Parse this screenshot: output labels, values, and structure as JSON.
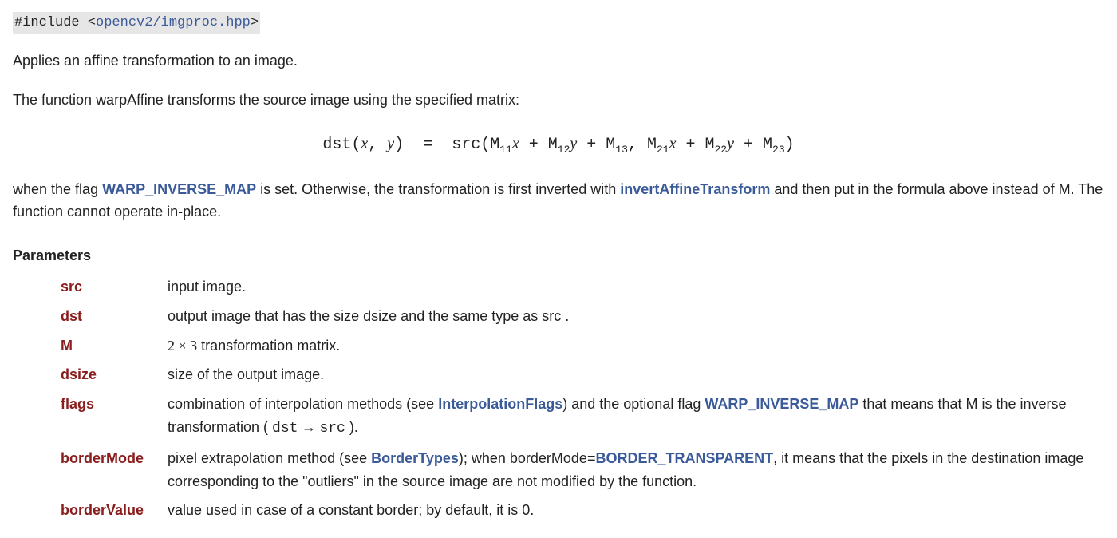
{
  "include": {
    "prefix": "#include <",
    "path": "opencv2/imgproc.hpp",
    "suffix": ">"
  },
  "intro1": "Applies an affine transformation to an image.",
  "intro2": "The function warpAffine transforms the source image using the specified matrix:",
  "formula": {
    "dst": "dst",
    "src": "src",
    "x": "x",
    "y": "y",
    "M11": "M",
    "s11": "11",
    "M12": "M",
    "s12": "12",
    "M13": "M",
    "s13": "13",
    "M21": "M",
    "s21": "21",
    "M22": "M",
    "s22": "22",
    "M23": "M",
    "s23": "23"
  },
  "afterFormula": {
    "t1": "when the flag ",
    "link1": "WARP_INVERSE_MAP",
    "t2": " is set. Otherwise, the transformation is first inverted with ",
    "link2": "invertAffineTransform",
    "t3": " and then put in the formula above instead of M. The function cannot operate in-place."
  },
  "paramsHeading": "Parameters",
  "params": {
    "src": {
      "name": "src",
      "desc": "input image."
    },
    "dst": {
      "name": "dst",
      "desc": "output image that has the size dsize and the same type as src ."
    },
    "M": {
      "name": "M",
      "pre": "2",
      "times": " × ",
      "post": "3",
      "rest": " transformation matrix."
    },
    "dsize": {
      "name": "dsize",
      "desc": "size of the output image."
    },
    "flags": {
      "name": "flags",
      "t1": "combination of interpolation methods (see ",
      "link1": "InterpolationFlags",
      "t2": ") and the optional flag ",
      "link2": "WARP_INVERSE_MAP",
      "t3": " that means that M is the inverse transformation ( ",
      "dst": "dst",
      "arrow": " → ",
      "src": "src",
      "t4": " )."
    },
    "borderMode": {
      "name": "borderMode",
      "t1": "pixel extrapolation method (see ",
      "link1": "BorderTypes",
      "t2": "); when borderMode=",
      "link2": "BORDER_TRANSPARENT",
      "t3": ", it means that the pixels in the destination image corresponding to the \"outliers\" in the source image are not modified by the function."
    },
    "borderValue": {
      "name": "borderValue",
      "desc": "value used in case of a constant border; by default, it is 0."
    }
  },
  "watermark": ""
}
